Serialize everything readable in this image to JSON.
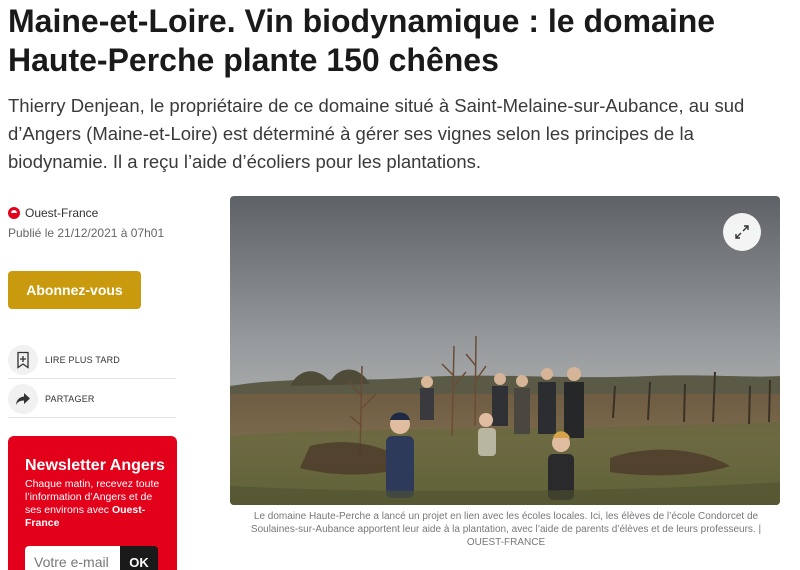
{
  "article": {
    "title": "Maine-et-Loire. Vin biodynamique : le domaine Haute-Perche plante 150 chênes",
    "lede": "Thierry Denjean, le propriétaire de ce domaine situé à Saint-Melaine-sur-Aubance, au sud d’Angers (Maine-et-Loire) est déterminé à gérer ses vignes selon les principes de la biodynamie. Il a reçu l’aide d’écoliers pour les plantations.",
    "source": "Ouest-France",
    "published": "Publié le 21/12/2021 à 07h01",
    "caption": "Le domaine Haute-Perche a lancé un projet en lien avec les écoles locales. Ici, les élèves de l’école Condorcet de Soulaines-sur-Aubance apportent leur aide à la plantation, avec l’aide de parents d’élèves et de leurs professeurs. | OUEST-FRANCE"
  },
  "actions": {
    "subscribe_label": "Abonnez-vous",
    "read_later_label": "LIRE PLUS TARD",
    "share_label": "PARTAGER"
  },
  "newsletter": {
    "title": "Newsletter Angers",
    "text": "Chaque matin, recevez toute l’information d’Angers et de ses environs avec",
    "brand": "Ouest-France",
    "email_placeholder": "Votre e-mail",
    "submit_label": "OK"
  },
  "icons": {
    "source_logo": "ouest-france-logo",
    "read_later": "bookmark-plus-icon",
    "share": "share-arrow-icon",
    "expand": "expand-icon"
  },
  "colors": {
    "brand_red": "#e2001a",
    "subscribe_gold": "#c99a0e"
  }
}
